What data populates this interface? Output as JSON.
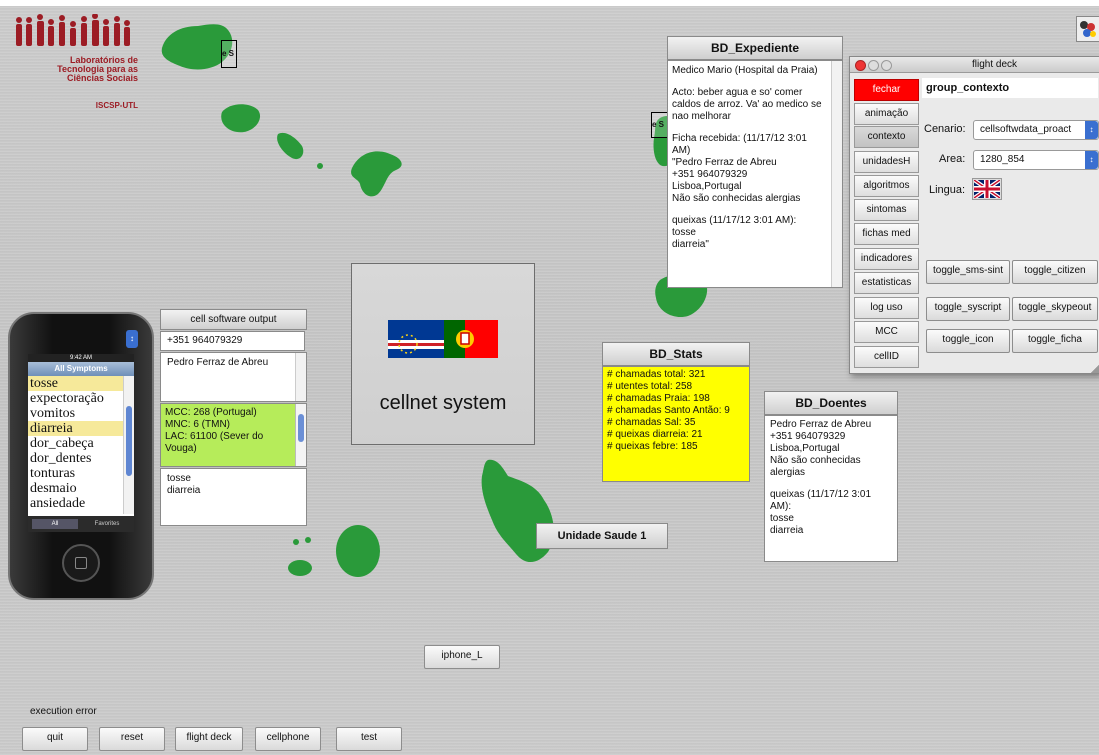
{
  "logo": {
    "line1": "Laboratórios de",
    "line2": "Tecnologia para as",
    "line3": "Ciências Sociais",
    "line4": "ISCSP-UTL"
  },
  "island_labels": {
    "island1": "e S",
    "island2": "e S"
  },
  "cellnet": {
    "title": "cellnet system"
  },
  "cell_output": {
    "header": "cell software output",
    "phone": "+351 964079329",
    "name": "Pedro Ferraz de Abreu",
    "network": [
      "MCC: 268 (Portugal)",
      "MNC: 6 (TMN)",
      "LAC: 61100 (Sever do Vouga)"
    ],
    "symptoms": [
      "tosse",
      "diarreia"
    ]
  },
  "bd_expediente": {
    "title": "BD_Expediente",
    "lines": [
      "Medico Mario (Hospital da Praia)",
      "",
      "Acto: beber agua e so' comer caldos de arroz. Va' ao medico se nao melhorar",
      "",
      "Ficha recebida: (11/17/12 3:01 AM)",
      "\"Pedro Ferraz de Abreu",
      "+351 964079329",
      "Lisboa,Portugal",
      "Não são conhecidas alergias",
      "",
      "queixas (11/17/12 3:01 AM):",
      "tosse",
      "diarreia\""
    ]
  },
  "bd_stats": {
    "title": "BD_Stats",
    "lines": [
      "# chamadas total: 321",
      "# utentes total: 258",
      "# chamadas Praia: 198",
      "# chamadas Santo Antão: 9",
      "# chamadas Sal: 35",
      "# queixas diarreia: 21",
      "# queixas febre: 185"
    ]
  },
  "bd_doentes": {
    "title": "BD_Doentes",
    "lines": [
      "Pedro Ferraz de Abreu",
      "+351 964079329",
      "Lisboa,Portugal",
      "Não são conhecidas alergias",
      "",
      "queixas (11/17/12 3:01 AM):",
      "tosse",
      "diarreia"
    ]
  },
  "unidade_saude": {
    "label": "Unidade Saude 1"
  },
  "iphone_button": {
    "label": "iphone_L"
  },
  "execution_error": "execution error",
  "bottom_buttons": [
    "quit",
    "reset",
    "flight deck",
    "cellphone",
    "test"
  ],
  "iphone": {
    "status_time": "9:42 AM",
    "header": "All Symptoms",
    "symptoms": [
      "tosse",
      "expectoração",
      "vomitos",
      "diarreia",
      "dor_cabeça",
      "dor_dentes",
      "tonturas",
      "desmaio",
      "ansiedade"
    ],
    "selected": [
      "tosse",
      "diarreia"
    ],
    "tabs": [
      "All",
      "Favorites"
    ]
  },
  "flight_deck": {
    "title": "flight deck",
    "group": "group_contexto",
    "side_buttons": [
      "fechar",
      "animação",
      "contexto",
      "unidadesH",
      "algoritmos",
      "sintomas",
      "fichas med",
      "indicadores",
      "estatisticas",
      "log uso",
      "MCC",
      "cellID"
    ],
    "cenario_label": "Cenario:",
    "cenario_value": "cellsoftwdata_proact",
    "area_label": "Area:",
    "area_value": "1280_854",
    "lingua_label": "Lingua:",
    "toggles": [
      "toggle_sms-sint",
      "toggle_citizen",
      "toggle_syscript",
      "toggle_skypeout",
      "toggle_icon",
      "toggle_ficha"
    ],
    "colors": {
      "close": "#ff0000",
      "fechar_bg": "#ff0000"
    }
  }
}
